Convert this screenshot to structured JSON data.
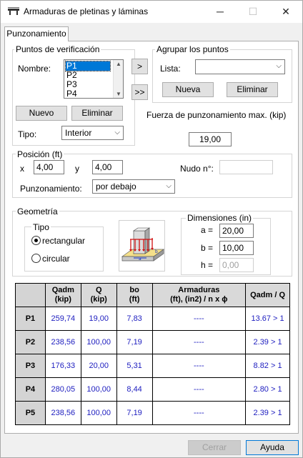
{
  "window": {
    "title": "Armaduras de pletinas y láminas",
    "icon": "plate-icon"
  },
  "tab": {
    "label": "Punzonamiento"
  },
  "verification": {
    "group_label": "Puntos de verificación",
    "nombre_label": "Nombre:",
    "points": [
      "P1",
      "P2",
      "P3",
      "P4"
    ],
    "selected": "P1",
    "new_button": "Nuevo",
    "delete_button": "Eliminar",
    "tipo_label": "Tipo:",
    "tipo_value": "Interior"
  },
  "move_buttons": {
    "single": ">",
    "all": ">>"
  },
  "grouping": {
    "group_label": "Agrupar los puntos",
    "lista_label": "Lista:",
    "lista_value": "",
    "new_button": "Nueva",
    "delete_button": "Eliminar"
  },
  "max_force": {
    "label": "Fuerza de punzonamiento max. (kip)",
    "value": "19,00"
  },
  "position": {
    "group_label": "Posición (ft)",
    "x_label": "x",
    "x_value": "4,00",
    "y_label": "y",
    "y_value": "4,00",
    "nudo_label": "Nudo n°:",
    "nudo_value": "",
    "punz_label": "Punzonamiento:",
    "punz_value": "por debajo"
  },
  "geometry": {
    "group_label": "Geometría",
    "tipo_label": "Tipo",
    "options": [
      "rectangular",
      "circular"
    ],
    "selected_option": "rectangular",
    "dims_label": "Dimensiones (in)",
    "a_label": "a =",
    "a_value": "20,00",
    "b_label": "b =",
    "b_value": "10,00",
    "h_label": "h =",
    "h_value": "0,00"
  },
  "table": {
    "headers": [
      "Qadm (kip)",
      "Q (kip)",
      "bo (ft)",
      "Armaduras (ft), (in2) / n x ϕ",
      "Qadm / Q"
    ],
    "header_lines": [
      [
        "Qadm",
        "(kip)"
      ],
      [
        "Q",
        "(kip)"
      ],
      [
        "bo",
        "(ft)"
      ],
      [
        "Armaduras",
        "(ft), (in2) / n x ϕ"
      ],
      [
        "Qadm / Q",
        ""
      ]
    ],
    "rows": [
      {
        "name": "P1",
        "qadm": "259,74",
        "q": "19,00",
        "bo": "7,83",
        "arm": "----",
        "ratio": "13.67 > 1"
      },
      {
        "name": "P2",
        "qadm": "238,56",
        "q": "100,00",
        "bo": "7,19",
        "arm": "----",
        "ratio": "2.39 > 1"
      },
      {
        "name": "P3",
        "qadm": "176,33",
        "q": "20,00",
        "bo": "5,31",
        "arm": "----",
        "ratio": "8.82 > 1"
      },
      {
        "name": "P4",
        "qadm": "280,05",
        "q": "100,00",
        "bo": "8,44",
        "arm": "----",
        "ratio": "2.80 > 1"
      },
      {
        "name": "P5",
        "qadm": "238,56",
        "q": "100,00",
        "bo": "7,19",
        "arm": "----",
        "ratio": "2.39 > 1"
      }
    ]
  },
  "footer": {
    "cancel_button": "Cerrar",
    "help_button": "Ayuda"
  },
  "colors": {
    "value_blue": "#2020c0",
    "selection": "#0078d7"
  }
}
